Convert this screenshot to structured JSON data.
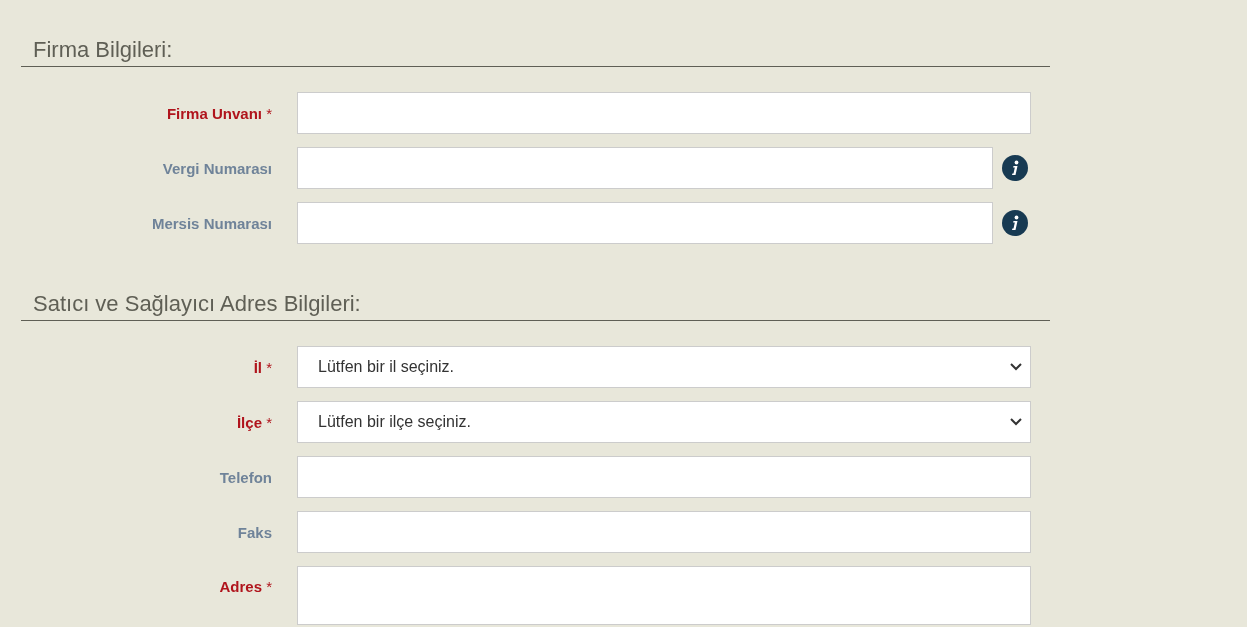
{
  "sections": [
    {
      "title": "Firma Bilgileri:",
      "fields": [
        {
          "label": "Firma Unvanı",
          "required": true,
          "mark": "*",
          "kind": "text"
        },
        {
          "label": "Vergi Numarası",
          "required": false,
          "kind": "text",
          "info": true
        },
        {
          "label": "Mersis Numarası",
          "required": false,
          "kind": "text",
          "info": true
        }
      ]
    },
    {
      "title": "Satıcı ve Sağlayıcı Adres Bilgileri:",
      "fields": [
        {
          "label": "İl",
          "required": true,
          "mark": "*",
          "kind": "select",
          "value": "Lütfen bir il seçiniz."
        },
        {
          "label": "İlçe",
          "required": true,
          "mark": "*",
          "kind": "select",
          "value": "Lütfen bir ilçe seçiniz."
        },
        {
          "label": "Telefon",
          "required": false,
          "kind": "text"
        },
        {
          "label": "Faks",
          "required": false,
          "kind": "text"
        },
        {
          "label": "Adres",
          "required": true,
          "mark": "*",
          "kind": "textarea"
        }
      ]
    }
  ]
}
